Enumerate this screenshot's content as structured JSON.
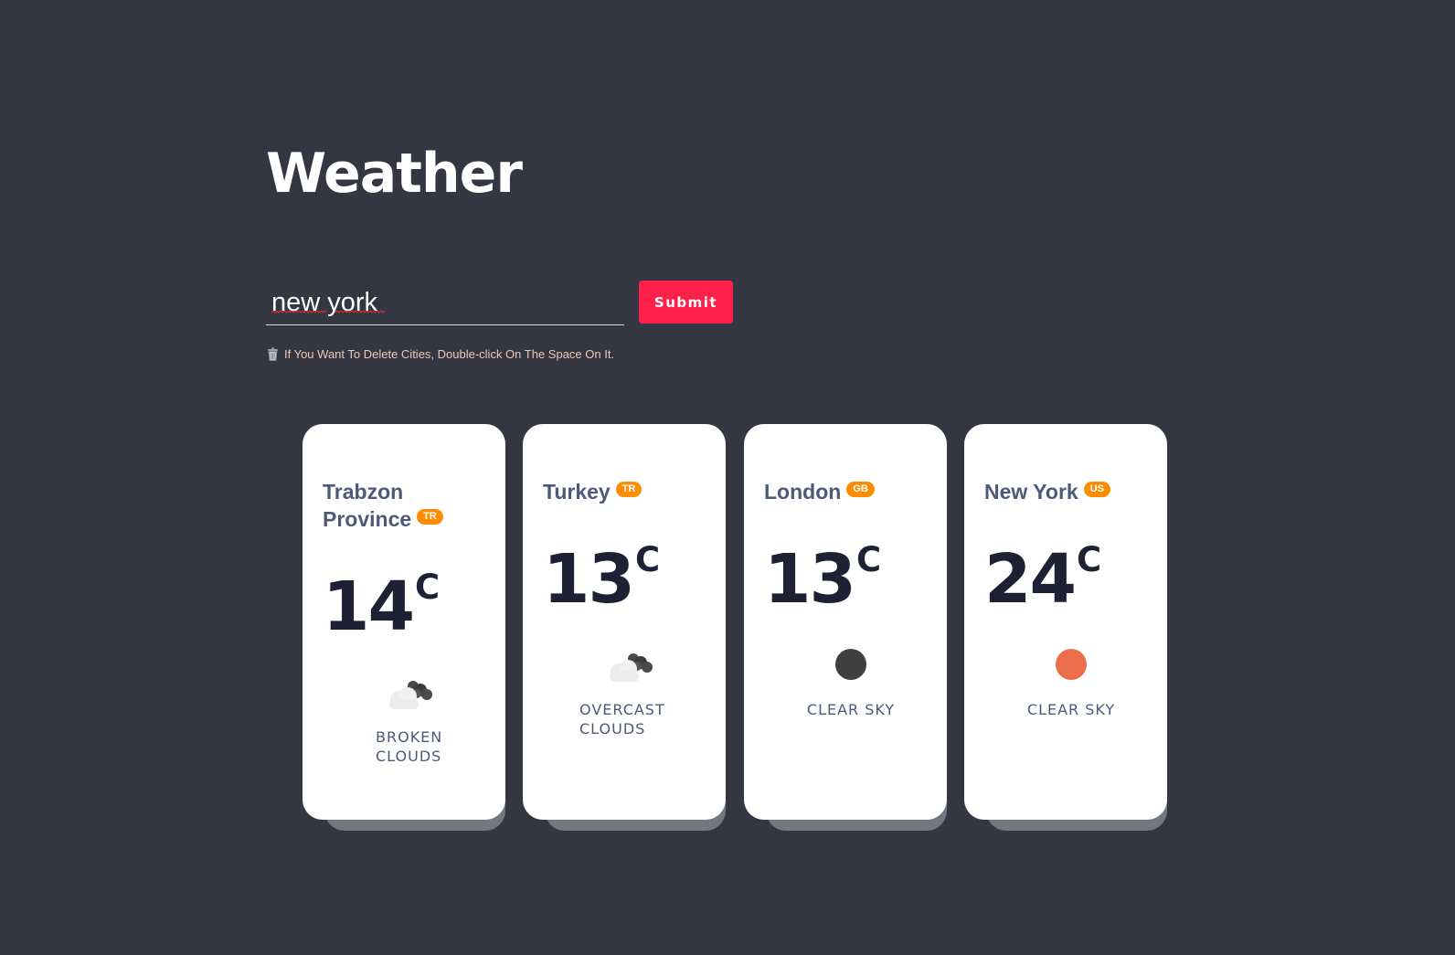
{
  "page": {
    "title": "Weather"
  },
  "search": {
    "value": "new york",
    "submit_label": "Submit"
  },
  "hint": {
    "text": "If You Want To Delete Cities, Double-click On The Space On It."
  },
  "colors": {
    "background": "#343741",
    "accent": "#ff1f4b",
    "badge": "#ff8c00",
    "sun": "#ec6e4c"
  },
  "cards": [
    {
      "city": "Trabzon Province",
      "country": "TR",
      "temperature": "14",
      "unit": "C",
      "icon": "broken-clouds-icon",
      "description": "BROKEN CLOUDS"
    },
    {
      "city": "Turkey",
      "country": "TR",
      "temperature": "13",
      "unit": "C",
      "icon": "overcast-clouds-icon",
      "description": "OVERCAST CLOUDS"
    },
    {
      "city": "London",
      "country": "GB",
      "temperature": "13",
      "unit": "C",
      "icon": "moon-icon",
      "description": "CLEAR SKY"
    },
    {
      "city": "New York",
      "country": "US",
      "temperature": "24",
      "unit": "C",
      "icon": "sun-icon",
      "description": "CLEAR SKY"
    }
  ]
}
